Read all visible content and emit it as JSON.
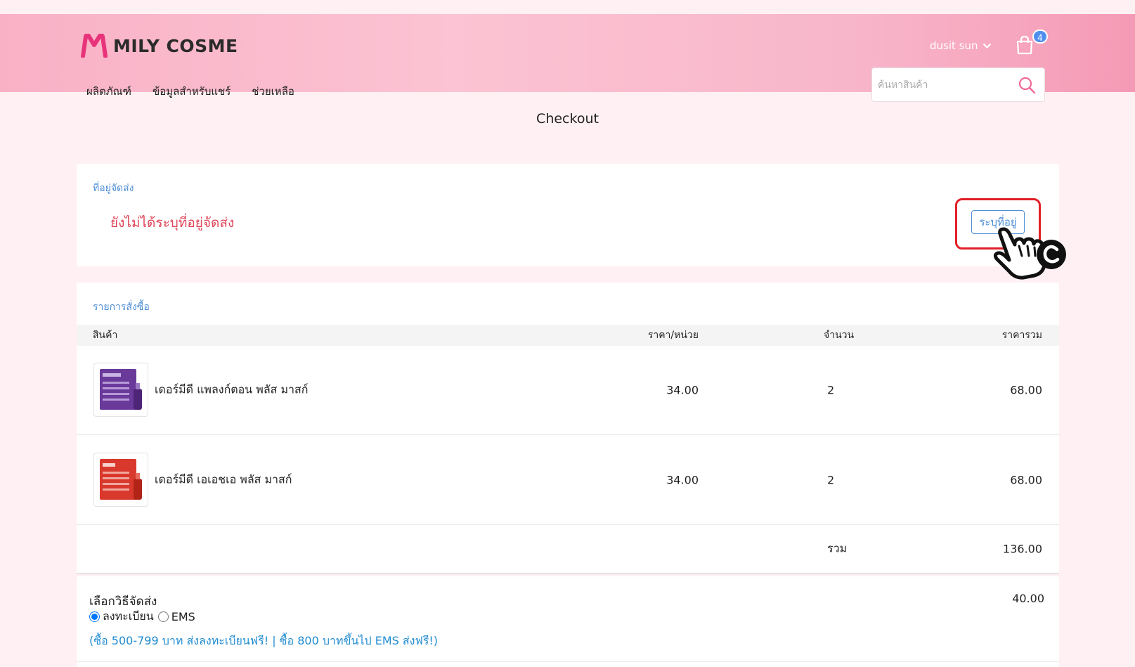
{
  "colors": {
    "header_gradient_start": "#f9b1c6",
    "header_gradient_end": "#f59ab6",
    "page_background": "#fff0f3",
    "accent_blue": "#4f8fd6",
    "warning_red": "#e0475a",
    "promo_blue": "#1f8bd0",
    "highlight_red": "#e21f26",
    "logo_pink": "#e8337a"
  },
  "header": {
    "logo_text": "MILY COSME",
    "nav": [
      "ผลิตภัณฑ์",
      "ข้อมูลสำหรับแชร์",
      "ช่วยเหลือ"
    ],
    "user_name": "dusit sun",
    "cart_count": "4",
    "search_placeholder": "ค้นหาสินค้า",
    "icons": [
      "logo-m-icon",
      "chevron-down-icon",
      "shopping-bag-icon",
      "search-icon"
    ]
  },
  "page_title": "Checkout",
  "address": {
    "label": "ที่อยู่จัดส่ง",
    "warning": "ยังไม่ได้ระบุที่อยู่จัดส่ง",
    "button": "ระบุที่อยู่"
  },
  "order": {
    "label": "รายการสั่งซื้อ",
    "columns": [
      "สินค้า",
      "ราคา/หน่วย",
      "จำนวน",
      "ราคารวม"
    ],
    "items": [
      {
        "name": "เดอร์มีดี แพลงก์ตอน พลัส มาสก์",
        "price": "34.00",
        "qty": "2",
        "total": "68.00",
        "thumb_color": "#6a3a9a"
      },
      {
        "name": "เดอร์มีดี เอเอชเอ พลัส มาสก์",
        "price": "34.00",
        "qty": "2",
        "total": "68.00",
        "thumb_color": "#d9382c"
      }
    ],
    "sum_label": "รวม",
    "sum_value": "136.00"
  },
  "shipping": {
    "title": "เลือกวิธีจัดส่ง",
    "price": "40.00",
    "options": [
      {
        "label": "ลงทะเบียน",
        "checked": true
      },
      {
        "label": "EMS",
        "checked": false
      }
    ],
    "promo": "(ซื้อ 500-799 บาท ส่งลงทะเบียนฟรี! | ซื้อ 800 บาทขึ้นไป EMS ส่งฟรี!)"
  }
}
